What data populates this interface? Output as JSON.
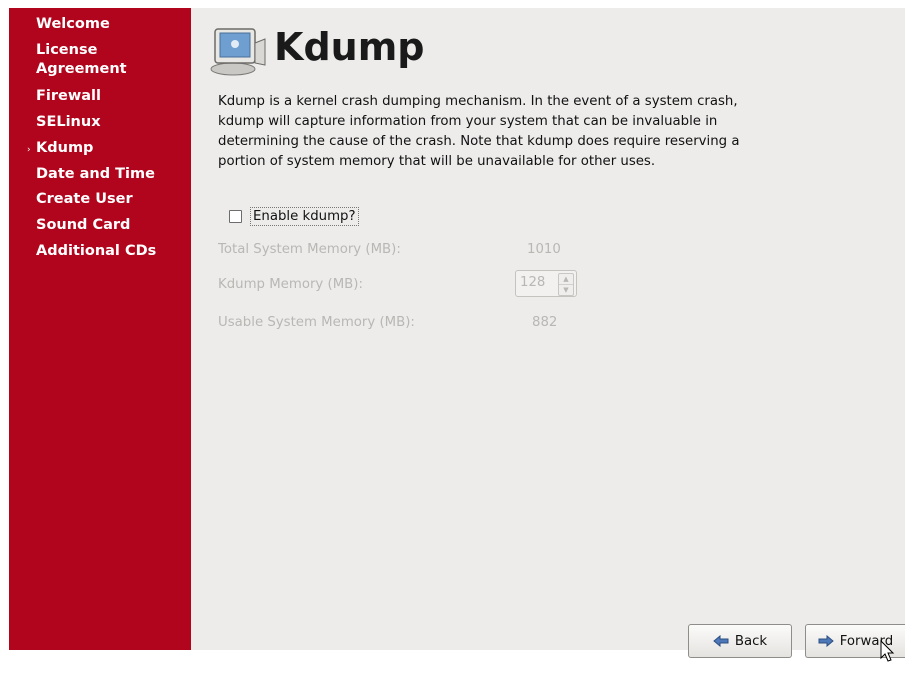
{
  "sidebar": {
    "items": [
      {
        "label": "Welcome"
      },
      {
        "label": "License"
      },
      {
        "label": "Agreement"
      },
      {
        "label": "Firewall"
      },
      {
        "label": "SELinux"
      },
      {
        "label": "Kdump"
      },
      {
        "label": "Date and Time"
      },
      {
        "label": "Create User"
      },
      {
        "label": "Sound Card"
      },
      {
        "label": "Additional CDs"
      }
    ],
    "active_marker": "›",
    "active_item": "Kdump",
    "color": "#b1051d"
  },
  "main": {
    "title": "Kdump",
    "title_icon": "computer-kdump-icon",
    "description": "Kdump is a kernel crash dumping mechanism. In the event of a system crash, kdump will capture information from your system that can be invaluable in determining the cause of the crash. Note that kdump does require reserving a portion of system memory that will be unavailable for other uses.",
    "enable_checkbox": {
      "label": "Enable kdump?",
      "checked": false
    },
    "total_memory": {
      "label": "Total System Memory (MB):",
      "value": "1010"
    },
    "kdump_memory": {
      "label": "Kdump Memory (MB):",
      "value": "128"
    },
    "usable_memory": {
      "label": "Usable System Memory (MB):",
      "value": "882"
    },
    "disabled_color": "#b9b7b4"
  },
  "buttons": {
    "back": "Back",
    "forward": "Forward"
  }
}
